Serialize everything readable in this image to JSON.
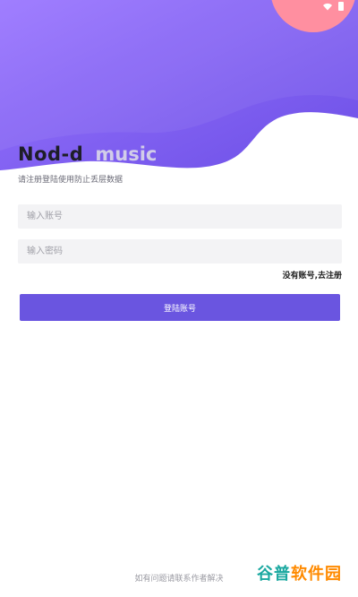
{
  "status_bar": {
    "wifi_icon": "wifi-icon",
    "battery_icon": "battery-icon"
  },
  "brand": {
    "title": "Nod-d",
    "title_ghost": "music"
  },
  "subtitle": "请注册登陆使用防止丢层数据",
  "form": {
    "account_placeholder": "输入账号",
    "password_placeholder": "输入密码",
    "register_link": "没有账号,去注册",
    "login_button": "登陆账号"
  },
  "footer_note": "如有问题请联系作者解决",
  "watermark": {
    "part1": "谷普",
    "part2": "软件园"
  },
  "colors": {
    "header_gradient_start": "#8d6bff",
    "header_gradient_end": "#6a4fe0",
    "accent": "#6a55e0",
    "pink_circle": "#ff8fa0"
  }
}
